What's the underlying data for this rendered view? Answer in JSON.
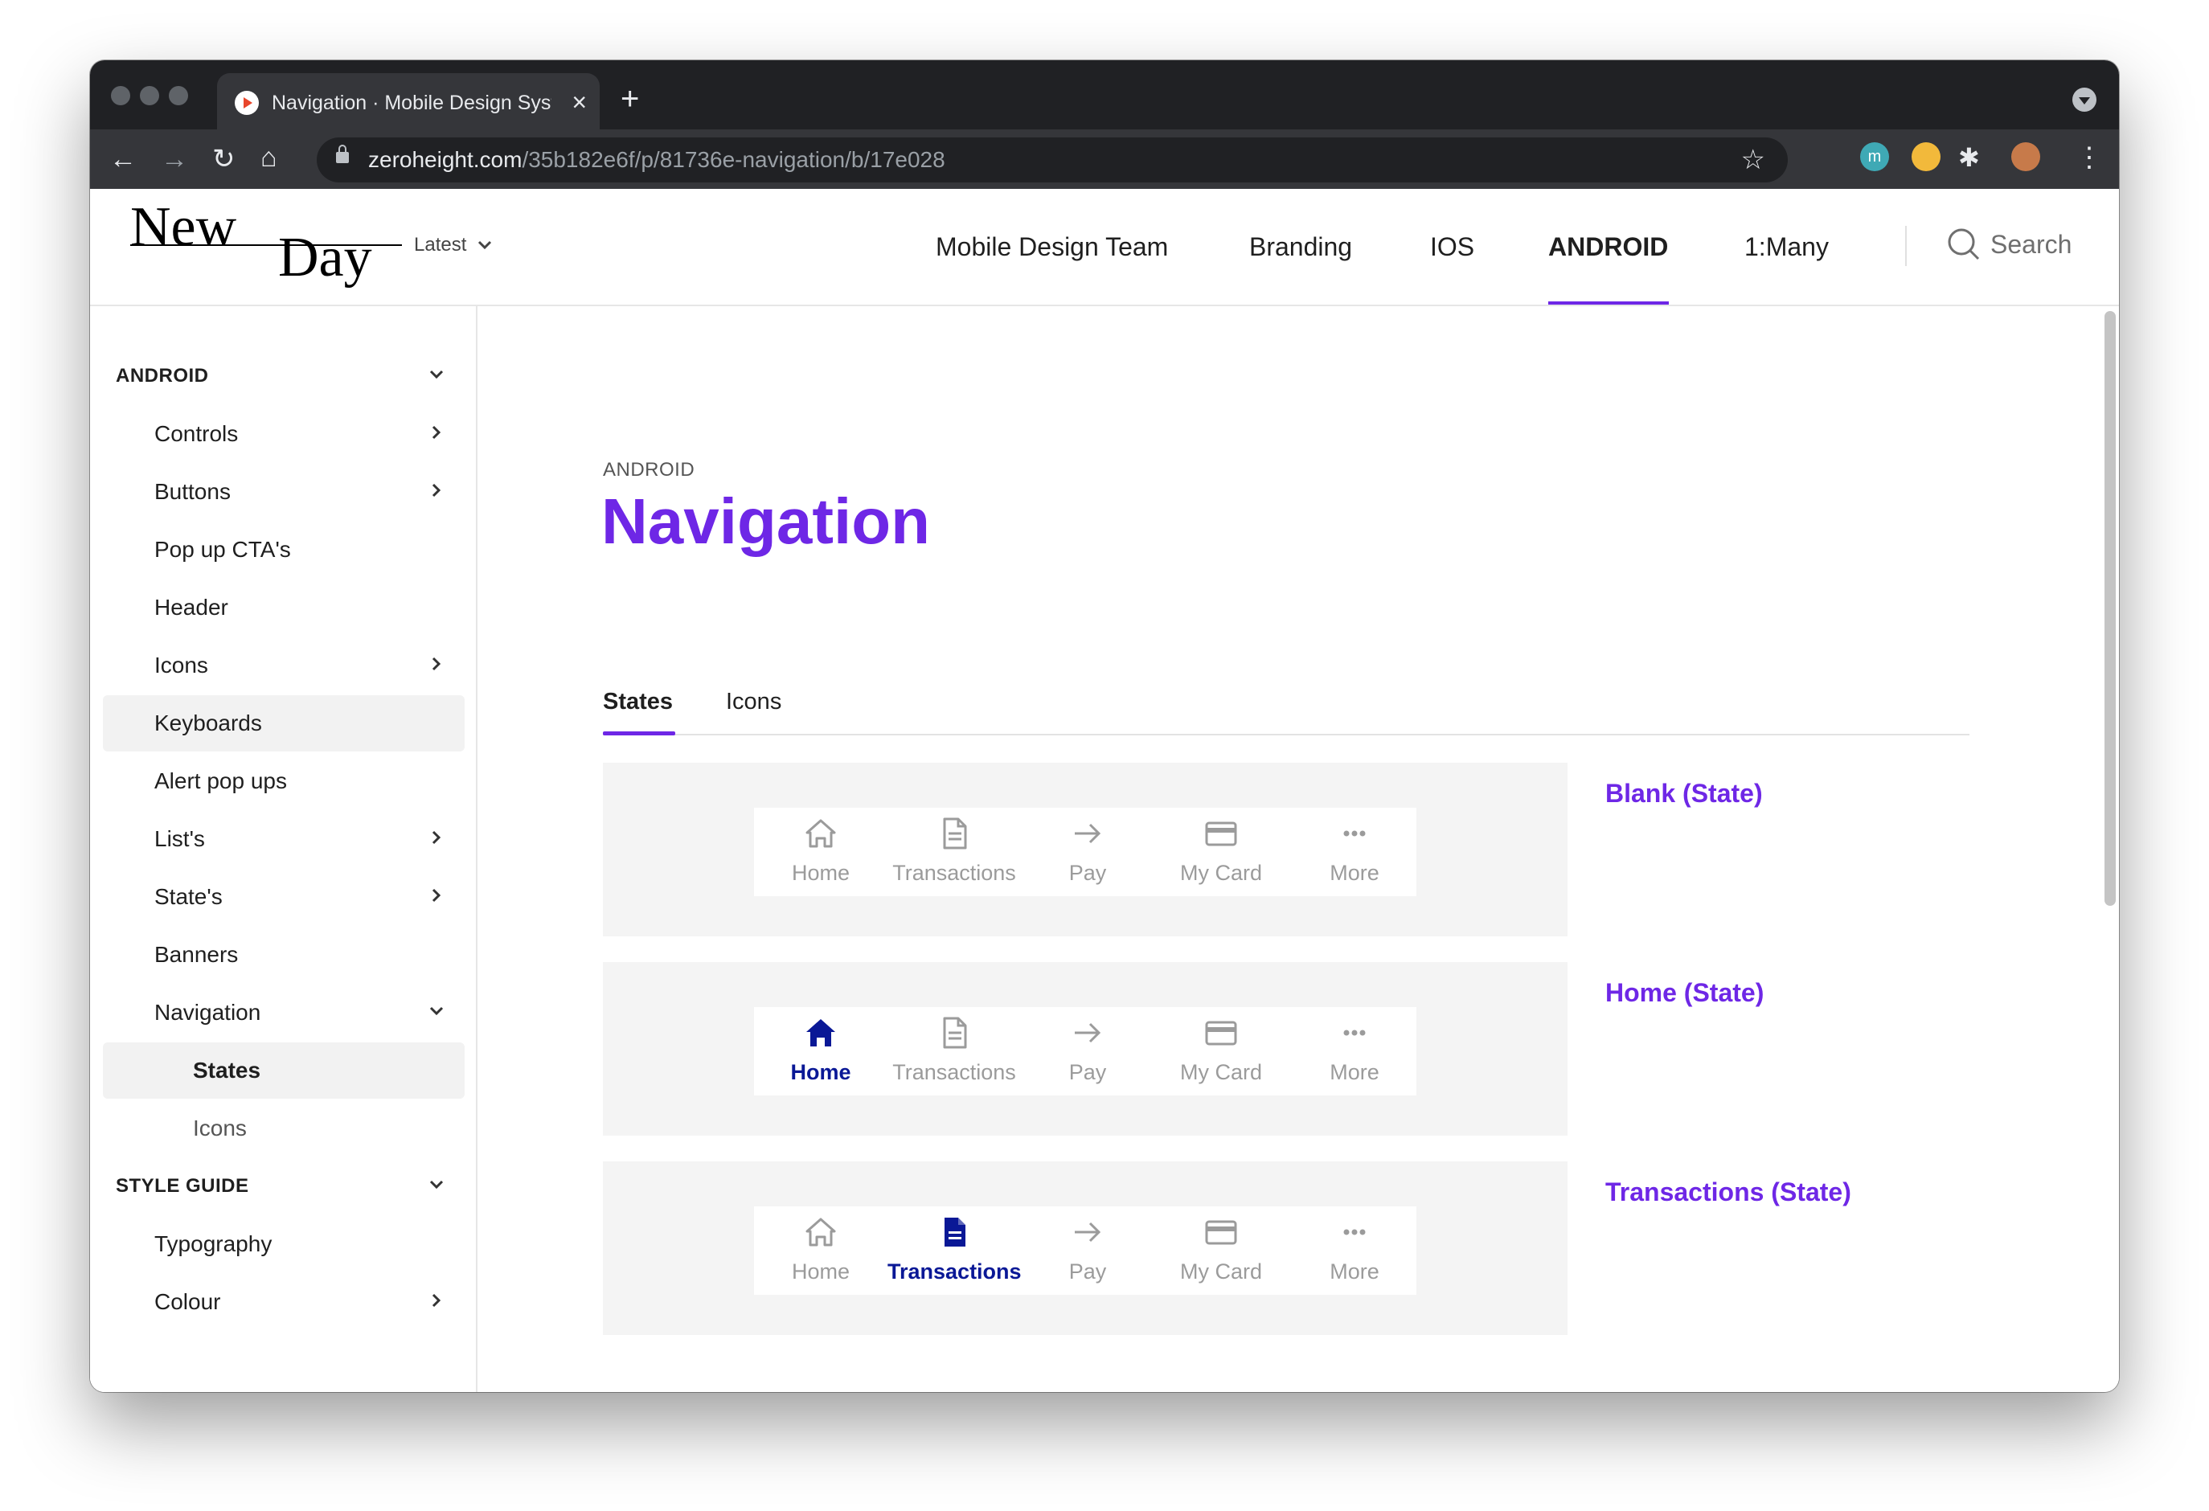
{
  "browser": {
    "tab_title": "Navigation · Mobile Design System",
    "url_host": "zeroheight.com",
    "url_path": "/35b182e6f/p/81736e-navigation/b/17e028",
    "ext_m_label": "m"
  },
  "header": {
    "logo_text_1": "New",
    "logo_text_2": "Day",
    "version_label": "Latest",
    "nav": [
      {
        "label": "Mobile Design Team"
      },
      {
        "label": "Branding"
      },
      {
        "label": "IOS"
      },
      {
        "label": "ANDROID"
      },
      {
        "label": "1:Many"
      }
    ],
    "active_nav": "ANDROID",
    "search_label": "Search"
  },
  "sidebar": {
    "section_android": "ANDROID",
    "items": [
      {
        "label": "Controls"
      },
      {
        "label": "Buttons"
      },
      {
        "label": "Pop up CTA's"
      },
      {
        "label": "Header"
      },
      {
        "label": "Icons"
      },
      {
        "label": "Keyboards"
      },
      {
        "label": "Alert pop ups"
      },
      {
        "label": "List's"
      },
      {
        "label": "State's"
      },
      {
        "label": "Banners"
      },
      {
        "label": "Navigation"
      }
    ],
    "sub_items": [
      {
        "label": "States"
      },
      {
        "label": "Icons"
      }
    ],
    "section_style": "STYLE GUIDE",
    "style_items": [
      {
        "label": "Typography"
      },
      {
        "label": "Colour"
      }
    ]
  },
  "content": {
    "eyebrow": "ANDROID",
    "title": "Navigation",
    "tabs": [
      {
        "label": "States"
      },
      {
        "label": "Icons"
      }
    ],
    "active_tab": "States",
    "bottom_nav_labels": [
      "Home",
      "Transactions",
      "Pay",
      "My Card",
      "More"
    ],
    "states": [
      {
        "title": "Blank (State)",
        "active_item": "none"
      },
      {
        "title": "Home (State)",
        "active_item": "Home"
      },
      {
        "title": "Transactions (State)",
        "active_item": "Transactions"
      }
    ]
  },
  "colors": {
    "accent_purple": "#6e27e6",
    "active_nav_blue": "#0a1896",
    "inactive_grey": "#9b9b9b"
  }
}
